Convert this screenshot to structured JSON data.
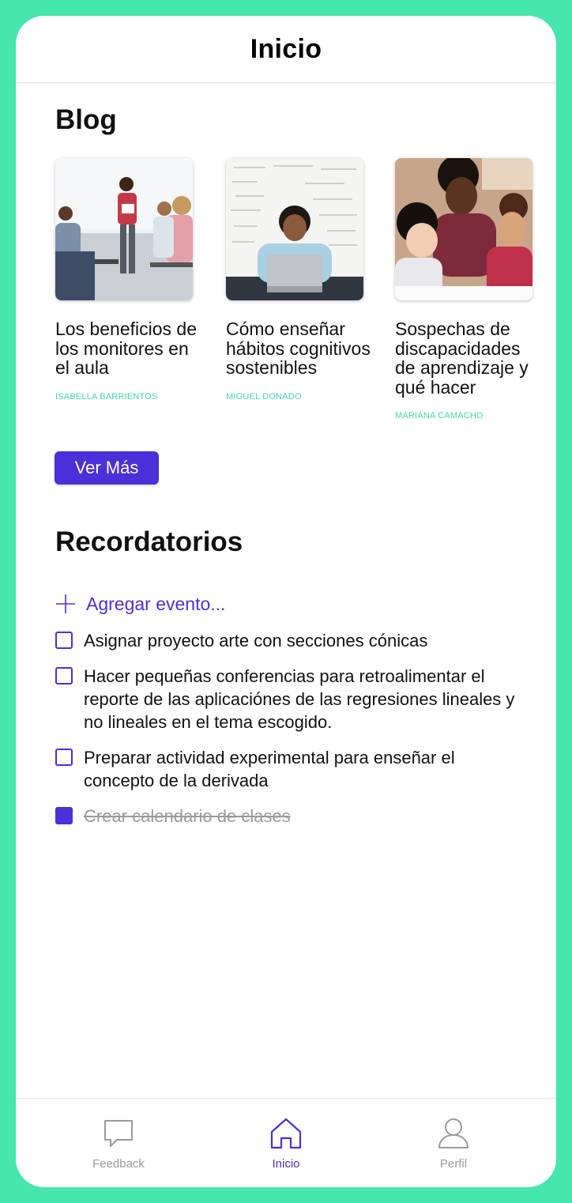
{
  "header": {
    "title": "Inicio"
  },
  "blog": {
    "title": "Blog",
    "posts": [
      {
        "title": "Los beneficios de los monitores en el aula",
        "author": "ISABELLA BARRIENTOS"
      },
      {
        "title": "Cómo enseñar hábitos cognitivos sostenibles",
        "author": "MIGUEL DONADO"
      },
      {
        "title": "Sospechas de discapacidades de aprendizaje y qué hacer",
        "author": "MARIANA CAMACHO"
      }
    ],
    "more_label": "Ver Más"
  },
  "reminders": {
    "title": "Recordatorios",
    "add_label": "Agregar evento...",
    "items": [
      {
        "text": "Asignar proyecto arte con secciones cónicas",
        "done": false
      },
      {
        "text": "Hacer pequeñas conferencias para retroalimentar el reporte de las aplicaciónes de las regresiones lineales y no lineales en el tema escogido.",
        "done": false
      },
      {
        "text": "Preparar actividad experimental para enseñar el concepto de la derivada",
        "done": false
      },
      {
        "text": "Crear calendario de clases",
        "done": true
      }
    ]
  },
  "tabbar": {
    "tabs": [
      {
        "label": "Feedback",
        "icon": "speech-bubble-icon",
        "active": false
      },
      {
        "label": "Inicio",
        "icon": "home-icon",
        "active": true
      },
      {
        "label": "Perfil",
        "icon": "person-icon",
        "active": false
      }
    ]
  },
  "colors": {
    "accent": "#4b2fd8",
    "frame": "#46e6ad",
    "author": "#3fd9a3"
  }
}
